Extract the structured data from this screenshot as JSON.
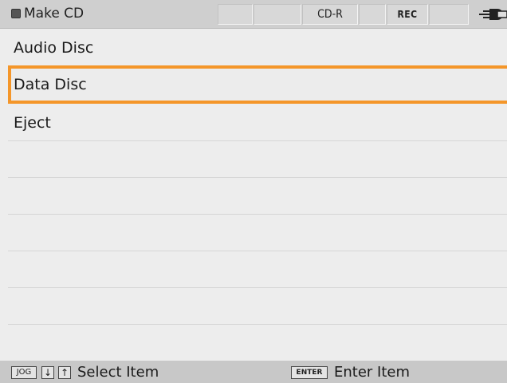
{
  "header": {
    "title": "Make CD",
    "indicators": [
      "",
      "",
      "CD-R",
      "",
      "REC",
      ""
    ],
    "stop_icon": "stop-square-icon",
    "battery_icon": "battery-plug-icon"
  },
  "menu": {
    "items": [
      {
        "label": "Audio Disc",
        "selected": false
      },
      {
        "label": "Data Disc",
        "selected": true
      },
      {
        "label": "Eject",
        "selected": false
      }
    ],
    "highlight_color": "#f4962a"
  },
  "footer": {
    "jog_key": "JOG",
    "down_key": "↓",
    "up_key": "↑",
    "select_text": "Select Item",
    "enter_key": "ENTER",
    "enter_text": "Enter Item"
  }
}
